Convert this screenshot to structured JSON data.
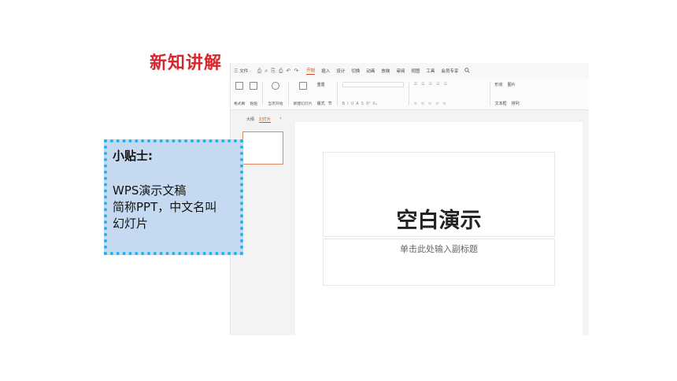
{
  "slide": {
    "heading": "新知讲解"
  },
  "app": {
    "menu": {
      "file": "三 文件 ·",
      "quick_access": [
        "⎙",
        "⌕",
        "⎘",
        "⎙",
        "↶",
        "↷"
      ],
      "tabs": [
        {
          "label": "开始",
          "active": true
        },
        {
          "label": "插入"
        },
        {
          "label": "设计"
        },
        {
          "label": "切换"
        },
        {
          "label": "动画"
        },
        {
          "label": "放映"
        },
        {
          "label": "审阅"
        },
        {
          "label": "视图"
        },
        {
          "label": "工具"
        },
        {
          "label": "会员专享"
        }
      ],
      "search_icon": "search-icon"
    },
    "ribbon": {
      "format_painter": "格式刷",
      "paste": "粘贴",
      "play_from_current": "当页开始",
      "new_slide": "新建幻灯片",
      "layout": "版式",
      "section": "节",
      "reset": "重置",
      "font_styles": [
        "B",
        "I",
        "U",
        "A",
        "S",
        "X²",
        "X₂"
      ],
      "shape": "形状",
      "picture": "图片",
      "textbox": "文本框",
      "arrange": "排列"
    },
    "pane": {
      "tab_outline": "大纲",
      "tab_slides": "幻灯片",
      "collapse": "‹"
    },
    "slide_canvas": {
      "title": "空白演示",
      "subtitle": "单击此处输入副标题"
    }
  },
  "tip": {
    "title": "小贴士:",
    "lines": [
      "WPS演示文稿",
      "简称PPT，中文名叫",
      "幻灯片"
    ]
  },
  "colors": {
    "heading": "#d8262c",
    "accent": "#d14d1b",
    "tip_bg": "#c5daf0",
    "tip_border": "#1fb6ef"
  }
}
